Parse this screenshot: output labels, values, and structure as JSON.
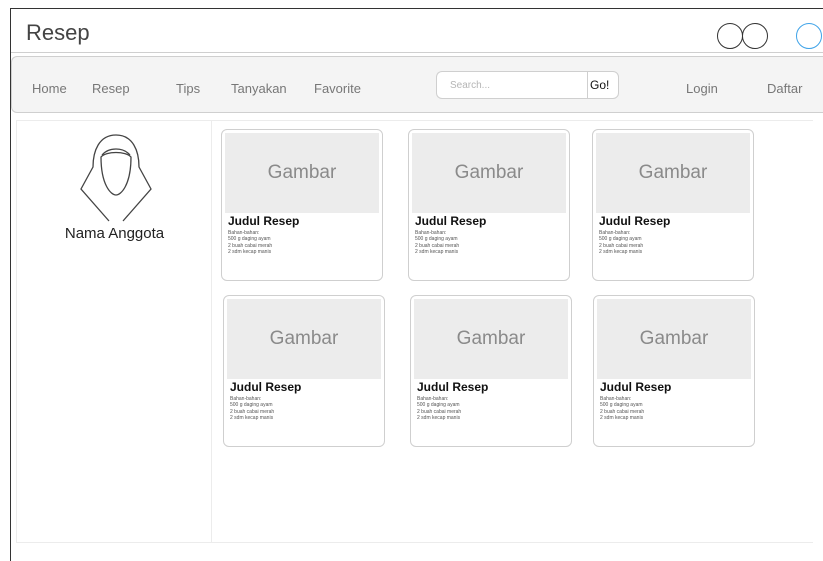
{
  "window": {
    "title": "Resep"
  },
  "nav": {
    "links": [
      "Home",
      "Resep",
      "Tips",
      "Tanyakan",
      "Favorite"
    ],
    "search_placeholder": "Search...",
    "go_label": "Go!",
    "login": "Login",
    "register": "Daftar"
  },
  "profile": {
    "name": "Nama Anggota",
    "avatar_icon": "user-icon"
  },
  "cards": [
    {
      "image": "Gambar",
      "title": "Judul Resep",
      "lines": [
        "Bahan-bahan:",
        "500 g daging ayam",
        "2 buah cabai merah",
        "2 sdm kecap manis"
      ]
    },
    {
      "image": "Gambar",
      "title": "Judul Resep",
      "lines": [
        "Bahan-bahan:",
        "500 g daging ayam",
        "2 buah cabai merah",
        "2 sdm kecap manis"
      ]
    },
    {
      "image": "Gambar",
      "title": "Judul Resep",
      "lines": [
        "Bahan-bahan:",
        "500 g daging ayam",
        "2 buah cabai merah",
        "2 sdm kecap manis"
      ]
    },
    {
      "image": "Gambar",
      "title": "Judul Resep",
      "lines": [
        "Bahan-bahan:",
        "500 g daging ayam",
        "2 buah cabai merah",
        "2 sdm kecap manis"
      ]
    },
    {
      "image": "Gambar",
      "title": "Judul Resep",
      "lines": [
        "Bahan-bahan:",
        "500 g daging ayam",
        "2 buah cabai merah",
        "2 sdm kecap manis"
      ]
    },
    {
      "image": "Gambar",
      "title": "Judul Resep",
      "lines": [
        "Bahan-bahan:",
        "500 g daging ayam",
        "2 buah cabai merah",
        "2 sdm kecap manis"
      ]
    }
  ],
  "colors": {
    "accent": "#3fa3e8",
    "nav_bg": "#f4f4f4",
    "image_bg": "#ececec"
  }
}
